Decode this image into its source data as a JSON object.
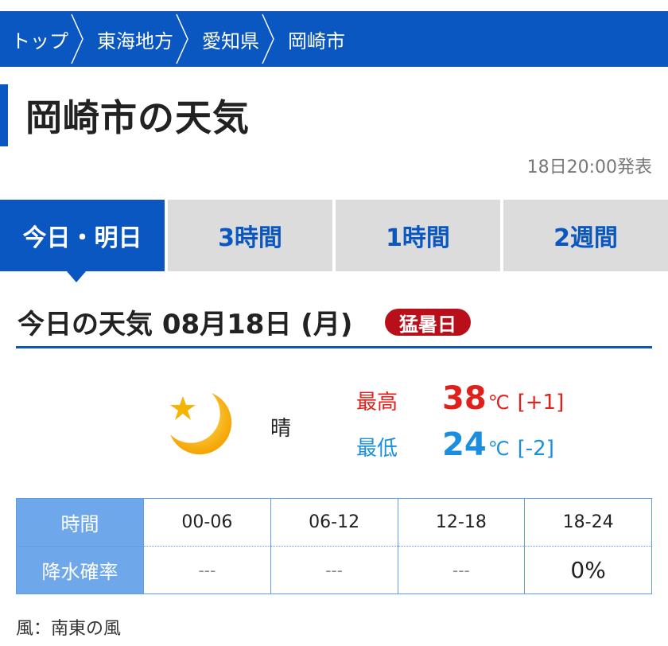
{
  "breadcrumb": [
    {
      "label": "トップ"
    },
    {
      "label": "東海地方"
    },
    {
      "label": "愛知県"
    },
    {
      "label": "岡崎市"
    }
  ],
  "page_title": "岡崎市の天気",
  "published": "18日20:00発表",
  "tabs": [
    {
      "label": "今日・明日",
      "active": true
    },
    {
      "label": "3時間",
      "active": false
    },
    {
      "label": "1時間",
      "active": false
    },
    {
      "label": "2週間",
      "active": false
    }
  ],
  "section": {
    "title": "今日の天気 08月18日 (月)",
    "badge": "猛暑日"
  },
  "weather": {
    "icon": "moon-star-icon",
    "label": "晴",
    "high": {
      "label": "最高",
      "value": "38",
      "unit": "℃",
      "diff": "[+1]"
    },
    "low": {
      "label": "最低",
      "value": "24",
      "unit": "℃",
      "diff": "[-2]"
    }
  },
  "rain_table": {
    "time_header": "時間",
    "rain_header": "降水確率",
    "periods": [
      "00-06",
      "06-12",
      "12-18",
      "18-24"
    ],
    "values": [
      "---",
      "---",
      "---",
      "0%"
    ]
  },
  "wind": "風：南東の風",
  "colors": {
    "brand_blue": "#0a57c2",
    "high_red": "#e0201a",
    "low_blue": "#1a8fe0",
    "badge_red": "#b80f1a",
    "table_head": "#6ea8ea"
  }
}
